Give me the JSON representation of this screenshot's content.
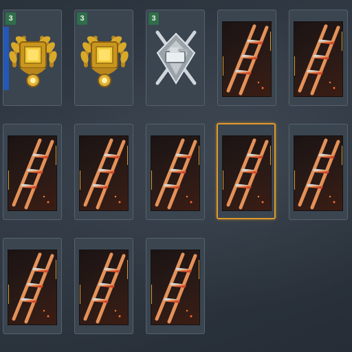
{
  "items": [
    {
      "kind": "gold-medal",
      "count": "3"
    },
    {
      "kind": "gold-medal",
      "count": "3"
    },
    {
      "kind": "silver-badge",
      "count": "3"
    },
    {
      "kind": "ladder-card"
    },
    {
      "kind": "ladder-card"
    },
    {
      "kind": "ladder-card"
    },
    {
      "kind": "ladder-card"
    },
    {
      "kind": "ladder-card"
    },
    {
      "kind": "ladder-card",
      "selected": true
    },
    {
      "kind": "ladder-card"
    },
    {
      "kind": "ladder-card"
    },
    {
      "kind": "ladder-card"
    },
    {
      "kind": "ladder-card"
    }
  ],
  "colors": {
    "accent": "#e19a2a",
    "count_badge": "#2f6e4a",
    "ladder_stripe": "#d8a23a"
  }
}
